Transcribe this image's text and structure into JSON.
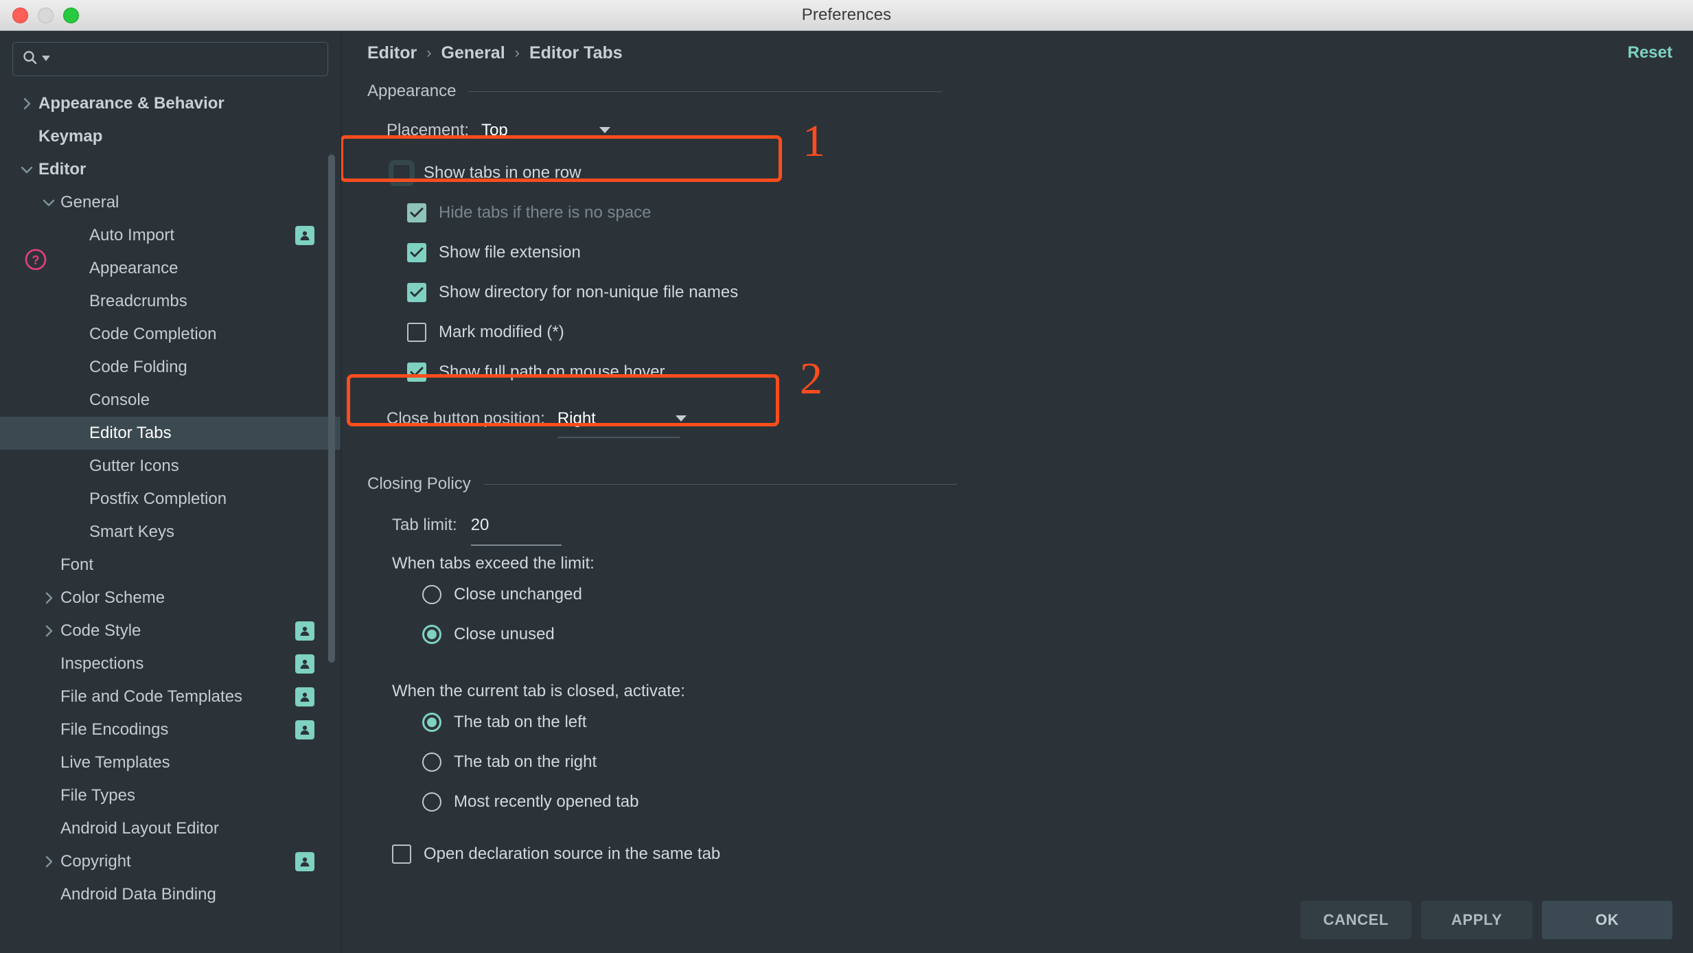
{
  "window": {
    "title": "Preferences",
    "controls": [
      "close-button",
      "minimize-button",
      "zoom-button"
    ]
  },
  "sidebar": {
    "search": {
      "value": "",
      "placeholder": ""
    },
    "items": [
      {
        "label": "Appearance & Behavior",
        "indent": 0,
        "arrow": "right",
        "bold": true,
        "badge": false,
        "selected": false
      },
      {
        "label": "Keymap",
        "indent": 0,
        "arrow": "none",
        "bold": true,
        "badge": false,
        "selected": false
      },
      {
        "label": "Editor",
        "indent": 0,
        "arrow": "down",
        "bold": true,
        "badge": false,
        "selected": false
      },
      {
        "label": "General",
        "indent": 1,
        "arrow": "down",
        "bold": false,
        "badge": false,
        "selected": false
      },
      {
        "label": "Auto Import",
        "indent": 2,
        "arrow": "none",
        "bold": false,
        "badge": true,
        "selected": false
      },
      {
        "label": "Appearance",
        "indent": 2,
        "arrow": "none",
        "bold": false,
        "badge": false,
        "selected": false
      },
      {
        "label": "Breadcrumbs",
        "indent": 2,
        "arrow": "none",
        "bold": false,
        "badge": false,
        "selected": false
      },
      {
        "label": "Code Completion",
        "indent": 2,
        "arrow": "none",
        "bold": false,
        "badge": false,
        "selected": false
      },
      {
        "label": "Code Folding",
        "indent": 2,
        "arrow": "none",
        "bold": false,
        "badge": false,
        "selected": false
      },
      {
        "label": "Console",
        "indent": 2,
        "arrow": "none",
        "bold": false,
        "badge": false,
        "selected": false
      },
      {
        "label": "Editor Tabs",
        "indent": 2,
        "arrow": "none",
        "bold": false,
        "badge": false,
        "selected": true
      },
      {
        "label": "Gutter Icons",
        "indent": 2,
        "arrow": "none",
        "bold": false,
        "badge": false,
        "selected": false
      },
      {
        "label": "Postfix Completion",
        "indent": 2,
        "arrow": "none",
        "bold": false,
        "badge": false,
        "selected": false
      },
      {
        "label": "Smart Keys",
        "indent": 2,
        "arrow": "none",
        "bold": false,
        "badge": false,
        "selected": false
      },
      {
        "label": "Font",
        "indent": 1,
        "arrow": "none",
        "bold": false,
        "badge": false,
        "selected": false
      },
      {
        "label": "Color Scheme",
        "indent": 1,
        "arrow": "right",
        "bold": false,
        "badge": false,
        "selected": false
      },
      {
        "label": "Code Style",
        "indent": 1,
        "arrow": "right",
        "bold": false,
        "badge": true,
        "selected": false
      },
      {
        "label": "Inspections",
        "indent": 1,
        "arrow": "none",
        "bold": false,
        "badge": true,
        "selected": false
      },
      {
        "label": "File and Code Templates",
        "indent": 1,
        "arrow": "none",
        "bold": false,
        "badge": true,
        "selected": false
      },
      {
        "label": "File Encodings",
        "indent": 1,
        "arrow": "none",
        "bold": false,
        "badge": true,
        "selected": false
      },
      {
        "label": "Live Templates",
        "indent": 1,
        "arrow": "none",
        "bold": false,
        "badge": false,
        "selected": false
      },
      {
        "label": "File Types",
        "indent": 1,
        "arrow": "none",
        "bold": false,
        "badge": false,
        "selected": false
      },
      {
        "label": "Android Layout Editor",
        "indent": 1,
        "arrow": "none",
        "bold": false,
        "badge": false,
        "selected": false
      },
      {
        "label": "Copyright",
        "indent": 1,
        "arrow": "right",
        "bold": false,
        "badge": true,
        "selected": false
      },
      {
        "label": "Android Data Binding",
        "indent": 1,
        "arrow": "none",
        "bold": false,
        "badge": false,
        "selected": false
      }
    ]
  },
  "header": {
    "breadcrumb": [
      "Editor",
      "General",
      "Editor Tabs"
    ],
    "separator": "›",
    "reset_label": "Reset"
  },
  "appearance": {
    "section_title": "Appearance",
    "placement": {
      "label": "Placement:",
      "value": "Top"
    },
    "show_tabs_one_row": {
      "label": "Show tabs in one row",
      "checked": false
    },
    "hide_tabs_no_space": {
      "label": "Hide tabs if there is no space",
      "checked": true,
      "disabled": true
    },
    "show_file_extension": {
      "label": "Show file extension",
      "checked": true
    },
    "show_directory": {
      "label": "Show directory for non-unique file names",
      "checked": true
    },
    "mark_modified": {
      "label": "Mark modified (*)",
      "checked": false
    },
    "show_full_path": {
      "label": "Show full path on mouse hover",
      "checked": true
    },
    "close_button_position": {
      "label": "Close button position:",
      "value": "Right"
    }
  },
  "closing_policy": {
    "section_title": "Closing Policy",
    "tab_limit": {
      "label": "Tab limit:",
      "value": "20"
    },
    "exceed_label": "When tabs exceed the limit:",
    "exceed_options": [
      {
        "label": "Close unchanged",
        "selected": false
      },
      {
        "label": "Close unused",
        "selected": true
      }
    ],
    "activate_label": "When the current tab is closed, activate:",
    "activate_options": [
      {
        "label": "The tab on the left",
        "selected": true
      },
      {
        "label": "The tab on the right",
        "selected": false
      },
      {
        "label": "Most recently opened tab",
        "selected": false
      }
    ],
    "open_declaration": {
      "label": "Open declaration source in the same tab",
      "checked": false
    }
  },
  "annotations": [
    {
      "number": "1",
      "target": "show-tabs-in-one-row"
    },
    {
      "number": "2",
      "target": "tab-limit"
    }
  ],
  "footer": {
    "help": "help-icon",
    "cancel_label": "CANCEL",
    "apply_label": "APPLY",
    "ok_label": "OK"
  },
  "colors": {
    "accent_teal": "#7fd1c1",
    "highlight_orange": "#ff4d1c",
    "background": "#2b3339",
    "selection": "#3b4950",
    "help_pink": "#e8417a"
  }
}
